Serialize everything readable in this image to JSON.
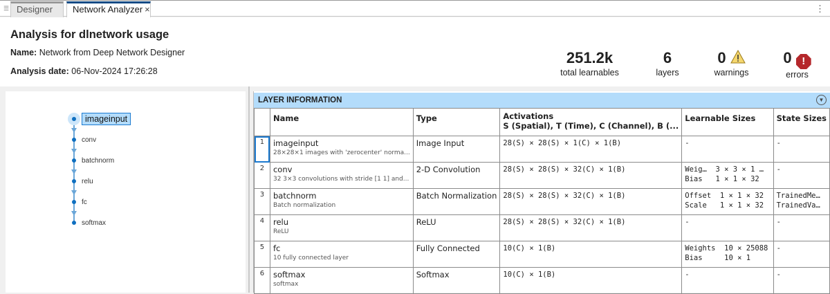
{
  "tabs": [
    {
      "label": "Designer"
    },
    {
      "label": "Network Analyzer",
      "close": "×"
    }
  ],
  "more_menu": "⋮",
  "header": {
    "title": "Analysis for dlnetwork usage",
    "name_label": "Name:",
    "name_value": "Network from Deep Network Designer",
    "date_label": "Analysis date:",
    "date_value": "06-Nov-2024 17:26:28"
  },
  "stats": {
    "learnables": {
      "value": "251.2k",
      "label": "total learnables"
    },
    "layers": {
      "value": "6",
      "label": "layers"
    },
    "warnings": {
      "value": "0",
      "label": "warnings",
      "icon": "!"
    },
    "errors": {
      "value": "0",
      "label": "errors",
      "icon": "!"
    }
  },
  "graph": {
    "nodes": [
      "imageinput",
      "conv",
      "batchnorm",
      "relu",
      "fc",
      "softmax"
    ]
  },
  "layer_info": {
    "title": "LAYER INFORMATION",
    "columns": [
      "",
      "Name",
      "Type",
      "Activations",
      "Learnable Sizes",
      "State Sizes"
    ],
    "activations_sub": "S (Spatial), T (Time), C (Channel), B (...",
    "rows": [
      {
        "idx": "1",
        "name": "imageinput",
        "desc": "28×28×1 images with 'zerocenter' norma...",
        "type": "Image Input",
        "act": "28(S) × 28(S) × 1(C) × 1(B)",
        "learn": "-",
        "state": "-"
      },
      {
        "idx": "2",
        "name": "conv",
        "desc": "32 3×3 convolutions with stride [1 1] and...",
        "type": "2-D Convolution",
        "act": "28(S) × 28(S) × 32(C) × 1(B)",
        "learn": "Weig…  3 × 3 × 1 …\nBias   1 × 1 × 32",
        "state": "-"
      },
      {
        "idx": "3",
        "name": "batchnorm",
        "desc": "Batch normalization",
        "type": "Batch Normalization",
        "act": "28(S) × 28(S) × 32(C) × 1(B)",
        "learn": "Offset  1 × 1 × 32\nScale   1 × 1 × 32",
        "state": "TrainedMe…\nTrainedVa…"
      },
      {
        "idx": "4",
        "name": "relu",
        "desc": "ReLU",
        "type": "ReLU",
        "act": "28(S) × 28(S) × 32(C) × 1(B)",
        "learn": "-",
        "state": "-"
      },
      {
        "idx": "5",
        "name": "fc",
        "desc": "10 fully connected layer",
        "type": "Fully Connected",
        "act": "10(C) × 1(B)",
        "learn": "Weights  10 × 25088\nBias     10 × 1",
        "state": "-"
      },
      {
        "idx": "6",
        "name": "softmax",
        "desc": "softmax",
        "type": "Softmax",
        "act": "10(C) × 1(B)",
        "learn": "-",
        "state": "-"
      }
    ]
  }
}
